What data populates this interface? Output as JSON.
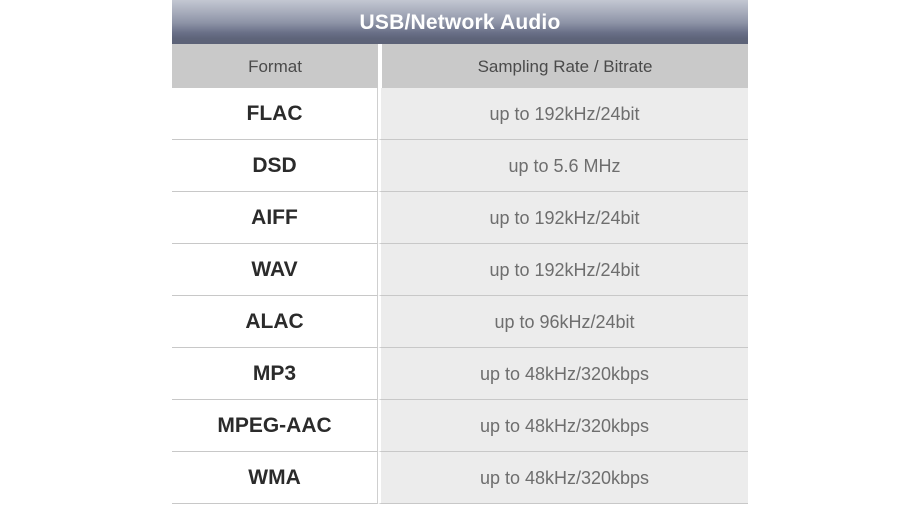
{
  "table": {
    "title": "USB/Network Audio",
    "columns": [
      {
        "key": "format",
        "label": "Format"
      },
      {
        "key": "rate",
        "label": "Sampling Rate / Bitrate"
      }
    ],
    "rows": [
      {
        "format": "FLAC",
        "rate": "up to 192kHz/24bit"
      },
      {
        "format": "DSD",
        "rate": "up to 5.6 MHz"
      },
      {
        "format": "AIFF",
        "rate": "up to 192kHz/24bit"
      },
      {
        "format": "WAV",
        "rate": "up to 192kHz/24bit"
      },
      {
        "format": "ALAC",
        "rate": "up to 96kHz/24bit"
      },
      {
        "format": "MP3",
        "rate": "up to 48kHz/320kbps"
      },
      {
        "format": "MPEG-AAC",
        "rate": "up to 48kHz/320kbps"
      },
      {
        "format": "WMA",
        "rate": "up to 48kHz/320kbps"
      }
    ],
    "colors": {
      "title_gradient_top": "#c3c7d2",
      "title_gradient_bottom": "#5c6277",
      "title_text": "#ffffff",
      "header_background": "#c9c9c9",
      "header_text": "#4a4a4a",
      "format_cell_background": "#ffffff",
      "format_text": "#2b2b2b",
      "rate_cell_background": "#ececec",
      "rate_text": "#6e6e6e",
      "row_divider": "#c8c8c8",
      "page_background": "#ffffff"
    }
  }
}
